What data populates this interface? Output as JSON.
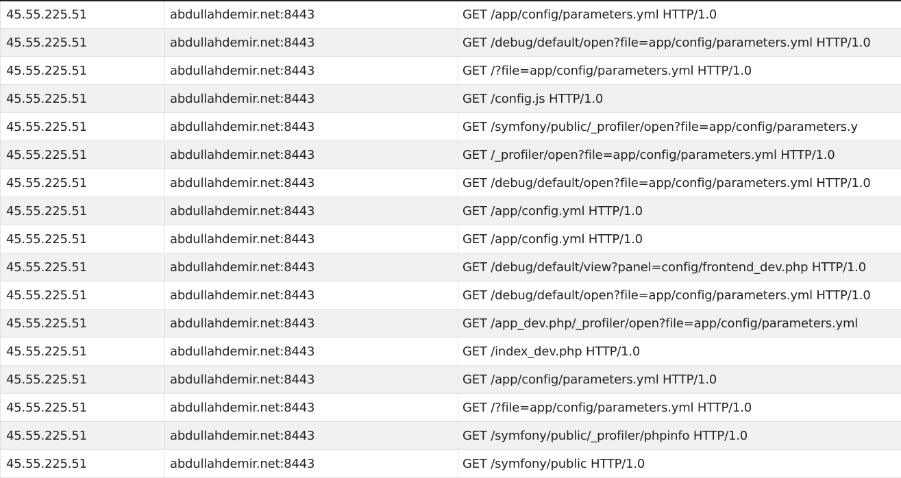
{
  "log_table": {
    "rows": [
      {
        "ip": "45.55.225.51",
        "host": "abdullahdemir.net:8443",
        "request": "GET /app/config/parameters.yml HTTP/1.0"
      },
      {
        "ip": "45.55.225.51",
        "host": "abdullahdemir.net:8443",
        "request": "GET /debug/default/open?file=app/config/parameters.yml HTTP/1.0"
      },
      {
        "ip": "45.55.225.51",
        "host": "abdullahdemir.net:8443",
        "request": "GET /?file=app/config/parameters.yml HTTP/1.0"
      },
      {
        "ip": "45.55.225.51",
        "host": "abdullahdemir.net:8443",
        "request": "GET /config.js HTTP/1.0"
      },
      {
        "ip": "45.55.225.51",
        "host": "abdullahdemir.net:8443",
        "request": "GET /symfony/public/_profiler/open?file=app/config/parameters.y"
      },
      {
        "ip": "45.55.225.51",
        "host": "abdullahdemir.net:8443",
        "request": "GET /_profiler/open?file=app/config/parameters.yml HTTP/1.0"
      },
      {
        "ip": "45.55.225.51",
        "host": "abdullahdemir.net:8443",
        "request": "GET /debug/default/open?file=app/config/parameters.yml HTTP/1.0"
      },
      {
        "ip": "45.55.225.51",
        "host": "abdullahdemir.net:8443",
        "request": "GET /app/config.yml HTTP/1.0"
      },
      {
        "ip": "45.55.225.51",
        "host": "abdullahdemir.net:8443",
        "request": "GET /app/config.yml HTTP/1.0"
      },
      {
        "ip": "45.55.225.51",
        "host": "abdullahdemir.net:8443",
        "request": "GET /debug/default/view?panel=config/frontend_dev.php HTTP/1.0"
      },
      {
        "ip": "45.55.225.51",
        "host": "abdullahdemir.net:8443",
        "request": "GET /debug/default/open?file=app/config/parameters.yml HTTP/1.0"
      },
      {
        "ip": "45.55.225.51",
        "host": "abdullahdemir.net:8443",
        "request": "GET /app_dev.php/_profiler/open?file=app/config/parameters.yml"
      },
      {
        "ip": "45.55.225.51",
        "host": "abdullahdemir.net:8443",
        "request": "GET /index_dev.php HTTP/1.0"
      },
      {
        "ip": "45.55.225.51",
        "host": "abdullahdemir.net:8443",
        "request": "GET /app/config/parameters.yml HTTP/1.0"
      },
      {
        "ip": "45.55.225.51",
        "host": "abdullahdemir.net:8443",
        "request": "GET /?file=app/config/parameters.yml HTTP/1.0"
      },
      {
        "ip": "45.55.225.51",
        "host": "abdullahdemir.net:8443",
        "request": "GET /symfony/public/_profiler/phpinfo HTTP/1.0"
      },
      {
        "ip": "45.55.225.51",
        "host": "abdullahdemir.net:8443",
        "request": "GET /symfony/public HTTP/1.0"
      }
    ]
  }
}
